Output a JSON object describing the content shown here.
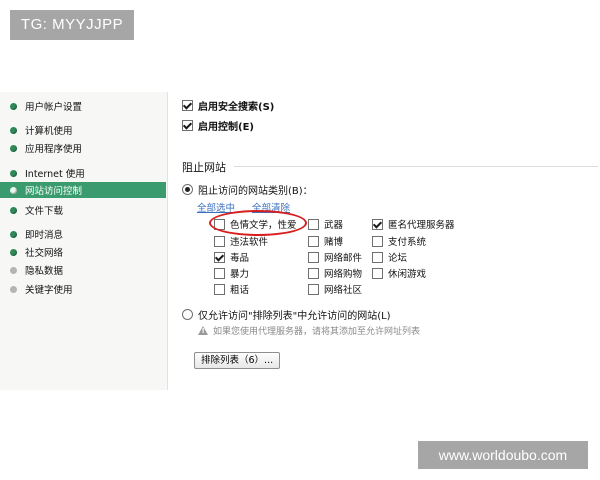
{
  "watermarks": {
    "top": "TG: MYYJJPP",
    "bottom": "www.worldoubo.com"
  },
  "sidebar": {
    "items": [
      {
        "label": "用户帐户设置",
        "dot": "green"
      },
      {
        "label": "计算机使用",
        "dot": "green"
      },
      {
        "label": "应用程序使用",
        "dot": "green"
      },
      {
        "label": "Internet 使用",
        "dot": "green"
      },
      {
        "label": "网站访问控制",
        "dot": "green",
        "active": true
      },
      {
        "label": "文件下载",
        "dot": "green"
      },
      {
        "label": "即时消息",
        "dot": "green"
      },
      {
        "label": "社交网络",
        "dot": "green"
      },
      {
        "label": "隐私数据",
        "dot": "grey"
      },
      {
        "label": "关键字使用",
        "dot": "grey"
      }
    ]
  },
  "main": {
    "safe_search": {
      "label": "启用安全搜索(S)",
      "checked": true
    },
    "control": {
      "label": "启用控制(E)",
      "checked": true
    },
    "section_title": "阻止网站",
    "radio_block": {
      "label": "阻止访问的网站类别(B)：",
      "selected": true
    },
    "select_all": "全部选中",
    "clear_all": "全部清除",
    "categories": [
      {
        "label": "色情文学，性爱",
        "checked": false
      },
      {
        "label": "违法软件",
        "checked": false
      },
      {
        "label": "毒品",
        "checked": true
      },
      {
        "label": "暴力",
        "checked": false
      },
      {
        "label": "粗话",
        "checked": false
      },
      {
        "label": "武器",
        "checked": false
      },
      {
        "label": "赌博",
        "checked": false
      },
      {
        "label": "网络邮件",
        "checked": false
      },
      {
        "label": "网络购物",
        "checked": false
      },
      {
        "label": "网络社区",
        "checked": false
      },
      {
        "label": "匿名代理服务器",
        "checked": true
      },
      {
        "label": "支付系统",
        "checked": false
      },
      {
        "label": "论坛",
        "checked": false
      },
      {
        "label": "休闲游戏",
        "checked": false
      }
    ],
    "radio_allow": {
      "label": "仅允许访问\"排除列表\"中允许访问的网站(L)",
      "selected": false
    },
    "hint": "如果您使用代理服务器，请将其添加至允许网址列表",
    "exclude_button": "排除列表（6）..."
  },
  "colors": {
    "active_bg": "#3a9c6e",
    "dot_green": "#2e8b57",
    "highlight_oval": "#d81e1e",
    "link": "#3a6fbf"
  }
}
